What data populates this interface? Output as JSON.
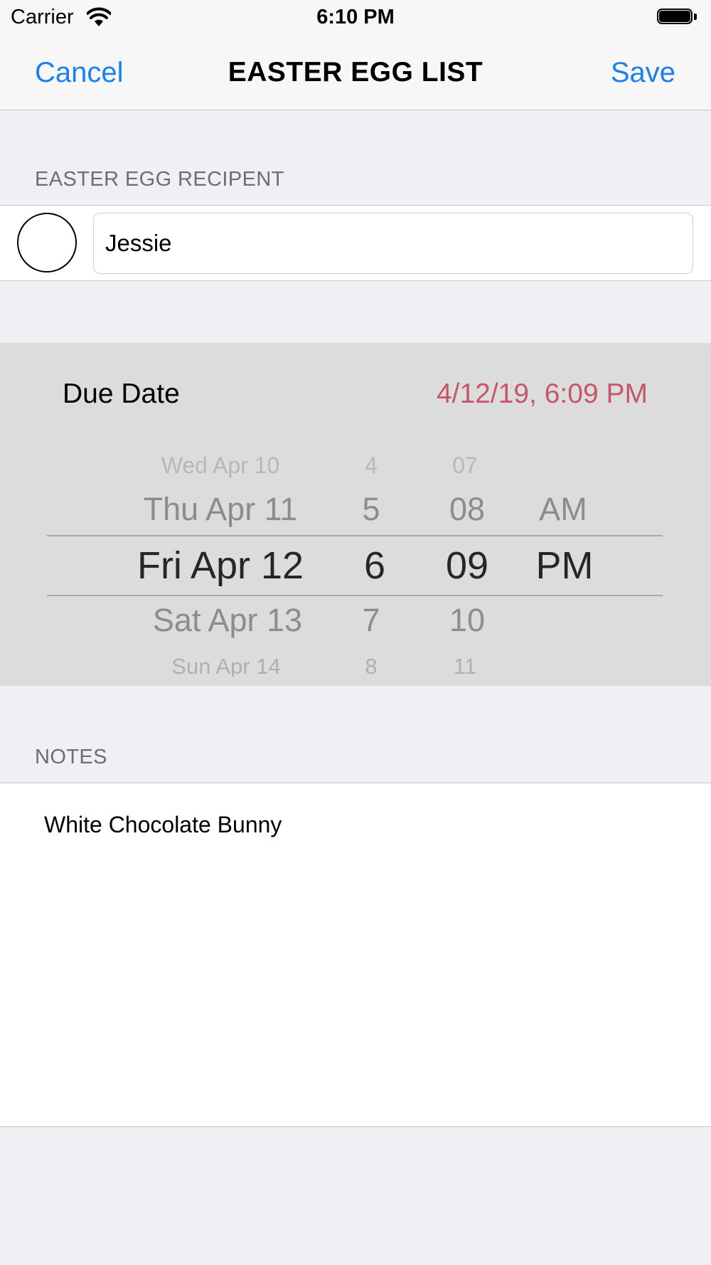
{
  "status_bar": {
    "carrier": "Carrier",
    "time": "6:10 PM"
  },
  "nav": {
    "cancel_label": "Cancel",
    "title": "EASTER EGG LIST",
    "save_label": "Save"
  },
  "recipient": {
    "header": "EASTER EGG RECIPENT",
    "name_value": "Jessie"
  },
  "due_date": {
    "label": "Due Date",
    "value": "4/12/19, 6:09 PM",
    "picker": {
      "dates": [
        "Wed Apr 10",
        "Thu Apr 11",
        "Fri Apr 12",
        "Sat Apr 13",
        "Sun Apr 14"
      ],
      "hours": [
        "4",
        "5",
        "6",
        "7",
        "8"
      ],
      "minutes": [
        "07",
        "08",
        "09",
        "10",
        "11"
      ],
      "periods": [
        "AM",
        "PM"
      ],
      "selected": {
        "date": "Fri Apr 12",
        "hour": "6",
        "minute": "09",
        "period": "PM"
      }
    }
  },
  "notes": {
    "header": "NOTES",
    "text": "White Chocolate Bunny"
  },
  "colors": {
    "accent": "#1a7ff0",
    "date_value": "#c8566a",
    "background": "#efeff4",
    "picker_bg": "#dcdcdc"
  }
}
